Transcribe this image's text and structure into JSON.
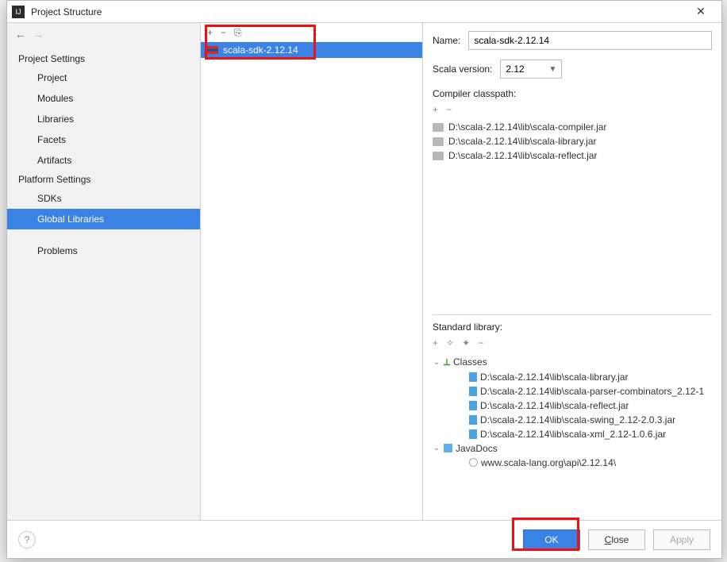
{
  "window": {
    "title": "Project Structure",
    "close_glyph": "✕"
  },
  "nav": {
    "back_glyph": "←",
    "fwd_glyph": "→"
  },
  "sidebar": {
    "group_project": "Project Settings",
    "project": "Project",
    "modules": "Modules",
    "libraries": "Libraries",
    "facets": "Facets",
    "artifacts": "Artifacts",
    "group_platform": "Platform Settings",
    "sdks": "SDKs",
    "global_libraries": "Global Libraries",
    "problems": "Problems"
  },
  "midtoolbar": {
    "add": "+",
    "remove": "−",
    "copy": "⎘"
  },
  "library_list": {
    "item0": "scala-sdk-2.12.14"
  },
  "detail": {
    "name_label": "Name:",
    "name_value": "scala-sdk-2.12.14",
    "scala_version_label": "Scala version:",
    "scala_version_value": "2.12",
    "compiler_label": "Compiler classpath:",
    "compiler_jars": {
      "j0": "D:\\scala-2.12.14\\lib\\scala-compiler.jar",
      "j1": "D:\\scala-2.12.14\\lib\\scala-library.jar",
      "j2": "D:\\scala-2.12.14\\lib\\scala-reflect.jar"
    },
    "stdlib_label": "Standard library:",
    "tree": {
      "classes_label": "Classes",
      "cls0": "D:\\scala-2.12.14\\lib\\scala-library.jar",
      "cls1": "D:\\scala-2.12.14\\lib\\scala-parser-combinators_2.12-1",
      "cls2": "D:\\scala-2.12.14\\lib\\scala-reflect.jar",
      "cls3": "D:\\scala-2.12.14\\lib\\scala-swing_2.12-2.0.3.jar",
      "cls4": "D:\\scala-2.12.14\\lib\\scala-xml_2.12-1.0.6.jar",
      "javadocs_label": "JavaDocs",
      "doc0": "www.scala-lang.org\\api\\2.12.14\\"
    }
  },
  "minibar": {
    "add": "+",
    "remove": "−",
    "addfolder": "✧",
    "addurl": "✦"
  },
  "footer": {
    "help": "?",
    "ok": "OK",
    "close": "Close",
    "apply": "Apply"
  }
}
